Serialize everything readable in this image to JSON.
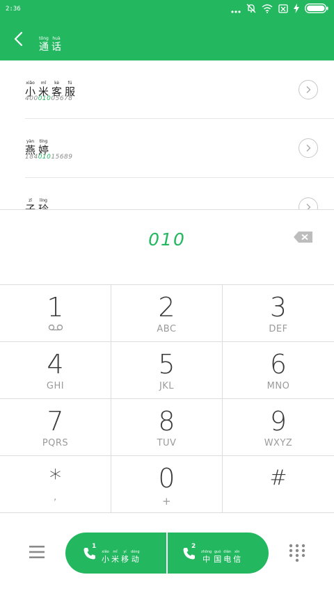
{
  "status": {
    "time": "2:36"
  },
  "header": {
    "title": [
      {
        "py": "tōng",
        "hz": "通"
      },
      {
        "py": "huà",
        "hz": "话"
      }
    ]
  },
  "contacts": [
    {
      "name": [
        {
          "py": "xiǎo",
          "hz": "小"
        },
        {
          "py": "mǐ",
          "hz": "米"
        },
        {
          "py": "kè",
          "hz": "客"
        },
        {
          "py": "fú",
          "hz": "服"
        }
      ],
      "number": {
        "pre": "400",
        "hl": "010",
        "post": "05678"
      }
    },
    {
      "name": [
        {
          "py": "yàn",
          "hz": "燕"
        },
        {
          "py": "tíng",
          "hz": "婷"
        }
      ],
      "number": {
        "pre": "184",
        "hl": "010",
        "post": "15689"
      }
    },
    {
      "name": [
        {
          "py": "zǐ",
          "hz": "子"
        },
        {
          "py": "líng",
          "hz": "玲"
        }
      ],
      "number": {
        "pre": "",
        "hl": "",
        "post": ""
      }
    }
  ],
  "dial": {
    "digits": "010"
  },
  "keypad": [
    {
      "digit": "1",
      "letters": ""
    },
    {
      "digit": "2",
      "letters": "ABC"
    },
    {
      "digit": "3",
      "letters": "DEF"
    },
    {
      "digit": "4",
      "letters": "GHI"
    },
    {
      "digit": "5",
      "letters": "JKL"
    },
    {
      "digit": "6",
      "letters": "MNO"
    },
    {
      "digit": "7",
      "letters": "PQRS"
    },
    {
      "digit": "8",
      "letters": "TUV"
    },
    {
      "digit": "9",
      "letters": "WXYZ"
    },
    {
      "digit": "*",
      "letters": ","
    },
    {
      "digit": "0",
      "letters": "+"
    },
    {
      "digit": "#",
      "letters": ""
    }
  ],
  "call": {
    "sim1": {
      "num": "1",
      "label": [
        {
          "py": "xiǎo",
          "hz": "小"
        },
        {
          "py": "mǐ",
          "hz": "米"
        },
        {
          "py": "yí",
          "hz": "移"
        },
        {
          "py": "dòng",
          "hz": "动"
        }
      ]
    },
    "sim2": {
      "num": "2",
      "label": [
        {
          "py": "zhōng",
          "hz": "中"
        },
        {
          "py": "guó",
          "hz": "国"
        },
        {
          "py": "diàn",
          "hz": "电"
        },
        {
          "py": "xìn",
          "hz": "信"
        }
      ]
    }
  },
  "colors": {
    "accent": "#23b860",
    "divider": "#dcdcdc"
  }
}
